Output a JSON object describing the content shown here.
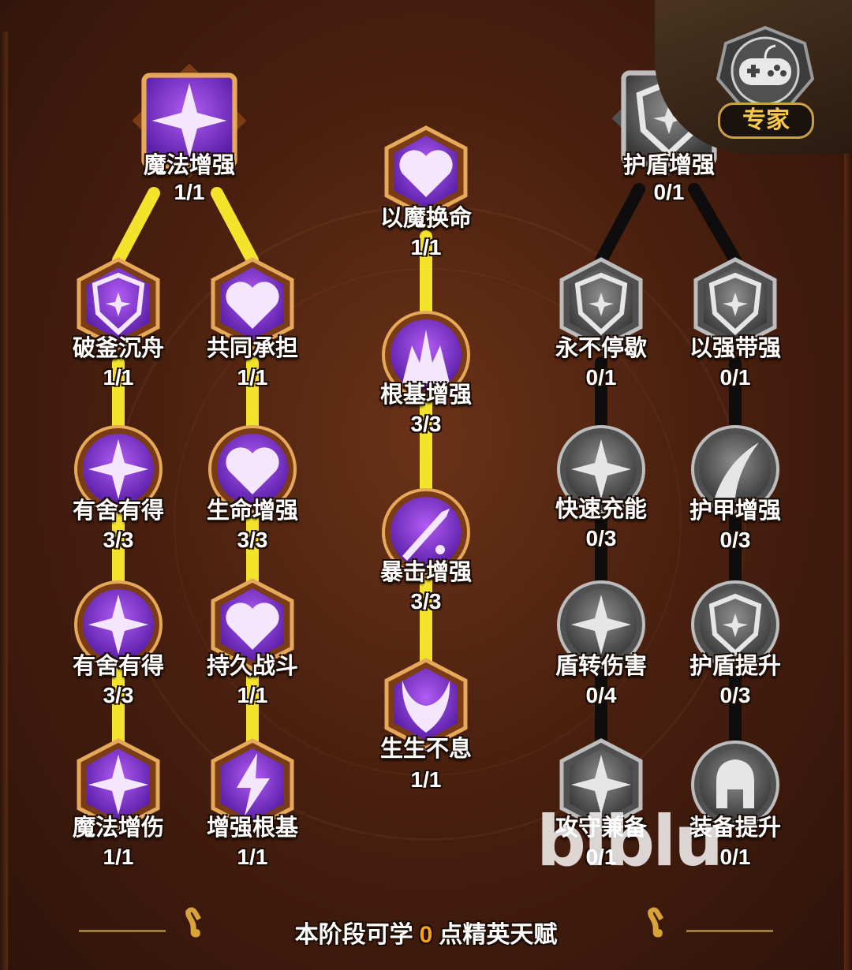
{
  "colors": {
    "active_link": "#f3e32a",
    "inactive_link": "#111111",
    "count_highlight": "#f7a21a",
    "expert_badge_text": "#f6c94a"
  },
  "expert_badge": {
    "label": "专家",
    "icon": "gamepad-icon"
  },
  "nodes": {
    "mofa_zengqiang": {
      "name": "魔法增强",
      "count": "1/1",
      "icon": "magic-star-icon",
      "state": "active"
    },
    "pofu_chenzhou": {
      "name": "破釜沉舟",
      "count": "1/1",
      "icon": "shield-star-icon",
      "state": "active"
    },
    "gongtong_chengdan": {
      "name": "共同承担",
      "count": "1/1",
      "icon": "heart-orbit-icon",
      "state": "active"
    },
    "youshe_youde_1": {
      "name": "有舍有得",
      "count": "3/3",
      "icon": "compass-star-icon",
      "state": "active"
    },
    "shengming_zengqiang": {
      "name": "生命增强",
      "count": "3/3",
      "icon": "heart-plus-icon",
      "state": "active"
    },
    "youshe_youde_2": {
      "name": "有舍有得",
      "count": "3/3",
      "icon": "compass-star-icon",
      "state": "active"
    },
    "chijiu_zhandou": {
      "name": "持久战斗",
      "count": "1/1",
      "icon": "shuriken-heart-icon",
      "state": "active"
    },
    "mofa_zengshang": {
      "name": "魔法增伤",
      "count": "1/1",
      "icon": "sparkle-up-icon",
      "state": "active"
    },
    "zengqiang_genji": {
      "name": "增强根基",
      "count": "1/1",
      "icon": "lightning-icon",
      "state": "active"
    },
    "yimo_huanming": {
      "name": "以魔换命",
      "count": "1/1",
      "icon": "heart-arrows-icon",
      "state": "active"
    },
    "genji_zengqiang": {
      "name": "根基增强",
      "count": "3/3",
      "icon": "crystal-spikes-icon",
      "state": "active"
    },
    "baoji_zengqiang": {
      "name": "暴击增强",
      "count": "3/3",
      "icon": "sword-burst-icon",
      "state": "active"
    },
    "shengsheng_buxi": {
      "name": "生生不息",
      "count": "1/1",
      "icon": "demon-mask-icon",
      "state": "active"
    },
    "hudun_zengqiang": {
      "name": "护盾增强",
      "count": "0/1",
      "icon": "shield-up-icon",
      "state": "locked"
    },
    "yongbu_tingxie": {
      "name": "永不停歇",
      "count": "0/1",
      "icon": "shield-star-icon",
      "state": "locked"
    },
    "yiqiang_daiqiang": {
      "name": "以强带强",
      "count": "0/1",
      "icon": "shield-plus-icon",
      "state": "locked"
    },
    "kuaisu_chongneng": {
      "name": "快速充能",
      "count": "0/3",
      "icon": "compass-star-icon",
      "state": "locked"
    },
    "hujia_zengqiang": {
      "name": "护甲增强",
      "count": "0/3",
      "icon": "claw-icon",
      "state": "locked"
    },
    "dunzhuan_shanghai": {
      "name": "盾转伤害",
      "count": "0/4",
      "icon": "compass-star-icon",
      "state": "locked"
    },
    "hudun_tisheng": {
      "name": "护盾提升",
      "count": "0/3",
      "icon": "shield-plus-icon",
      "state": "locked"
    },
    "gongshou_jianbei": {
      "name": "攻守兼备",
      "count": "0/1",
      "icon": "sparkle-up-icon",
      "state": "locked"
    },
    "zhuangbei_tisheng": {
      "name": "装备提升",
      "count": "0/1",
      "icon": "helmet-icon",
      "state": "locked"
    }
  },
  "footer": {
    "prefix": "本阶段可学",
    "points": "0",
    "suffix": "点精英天赋"
  },
  "watermark": "blblu"
}
